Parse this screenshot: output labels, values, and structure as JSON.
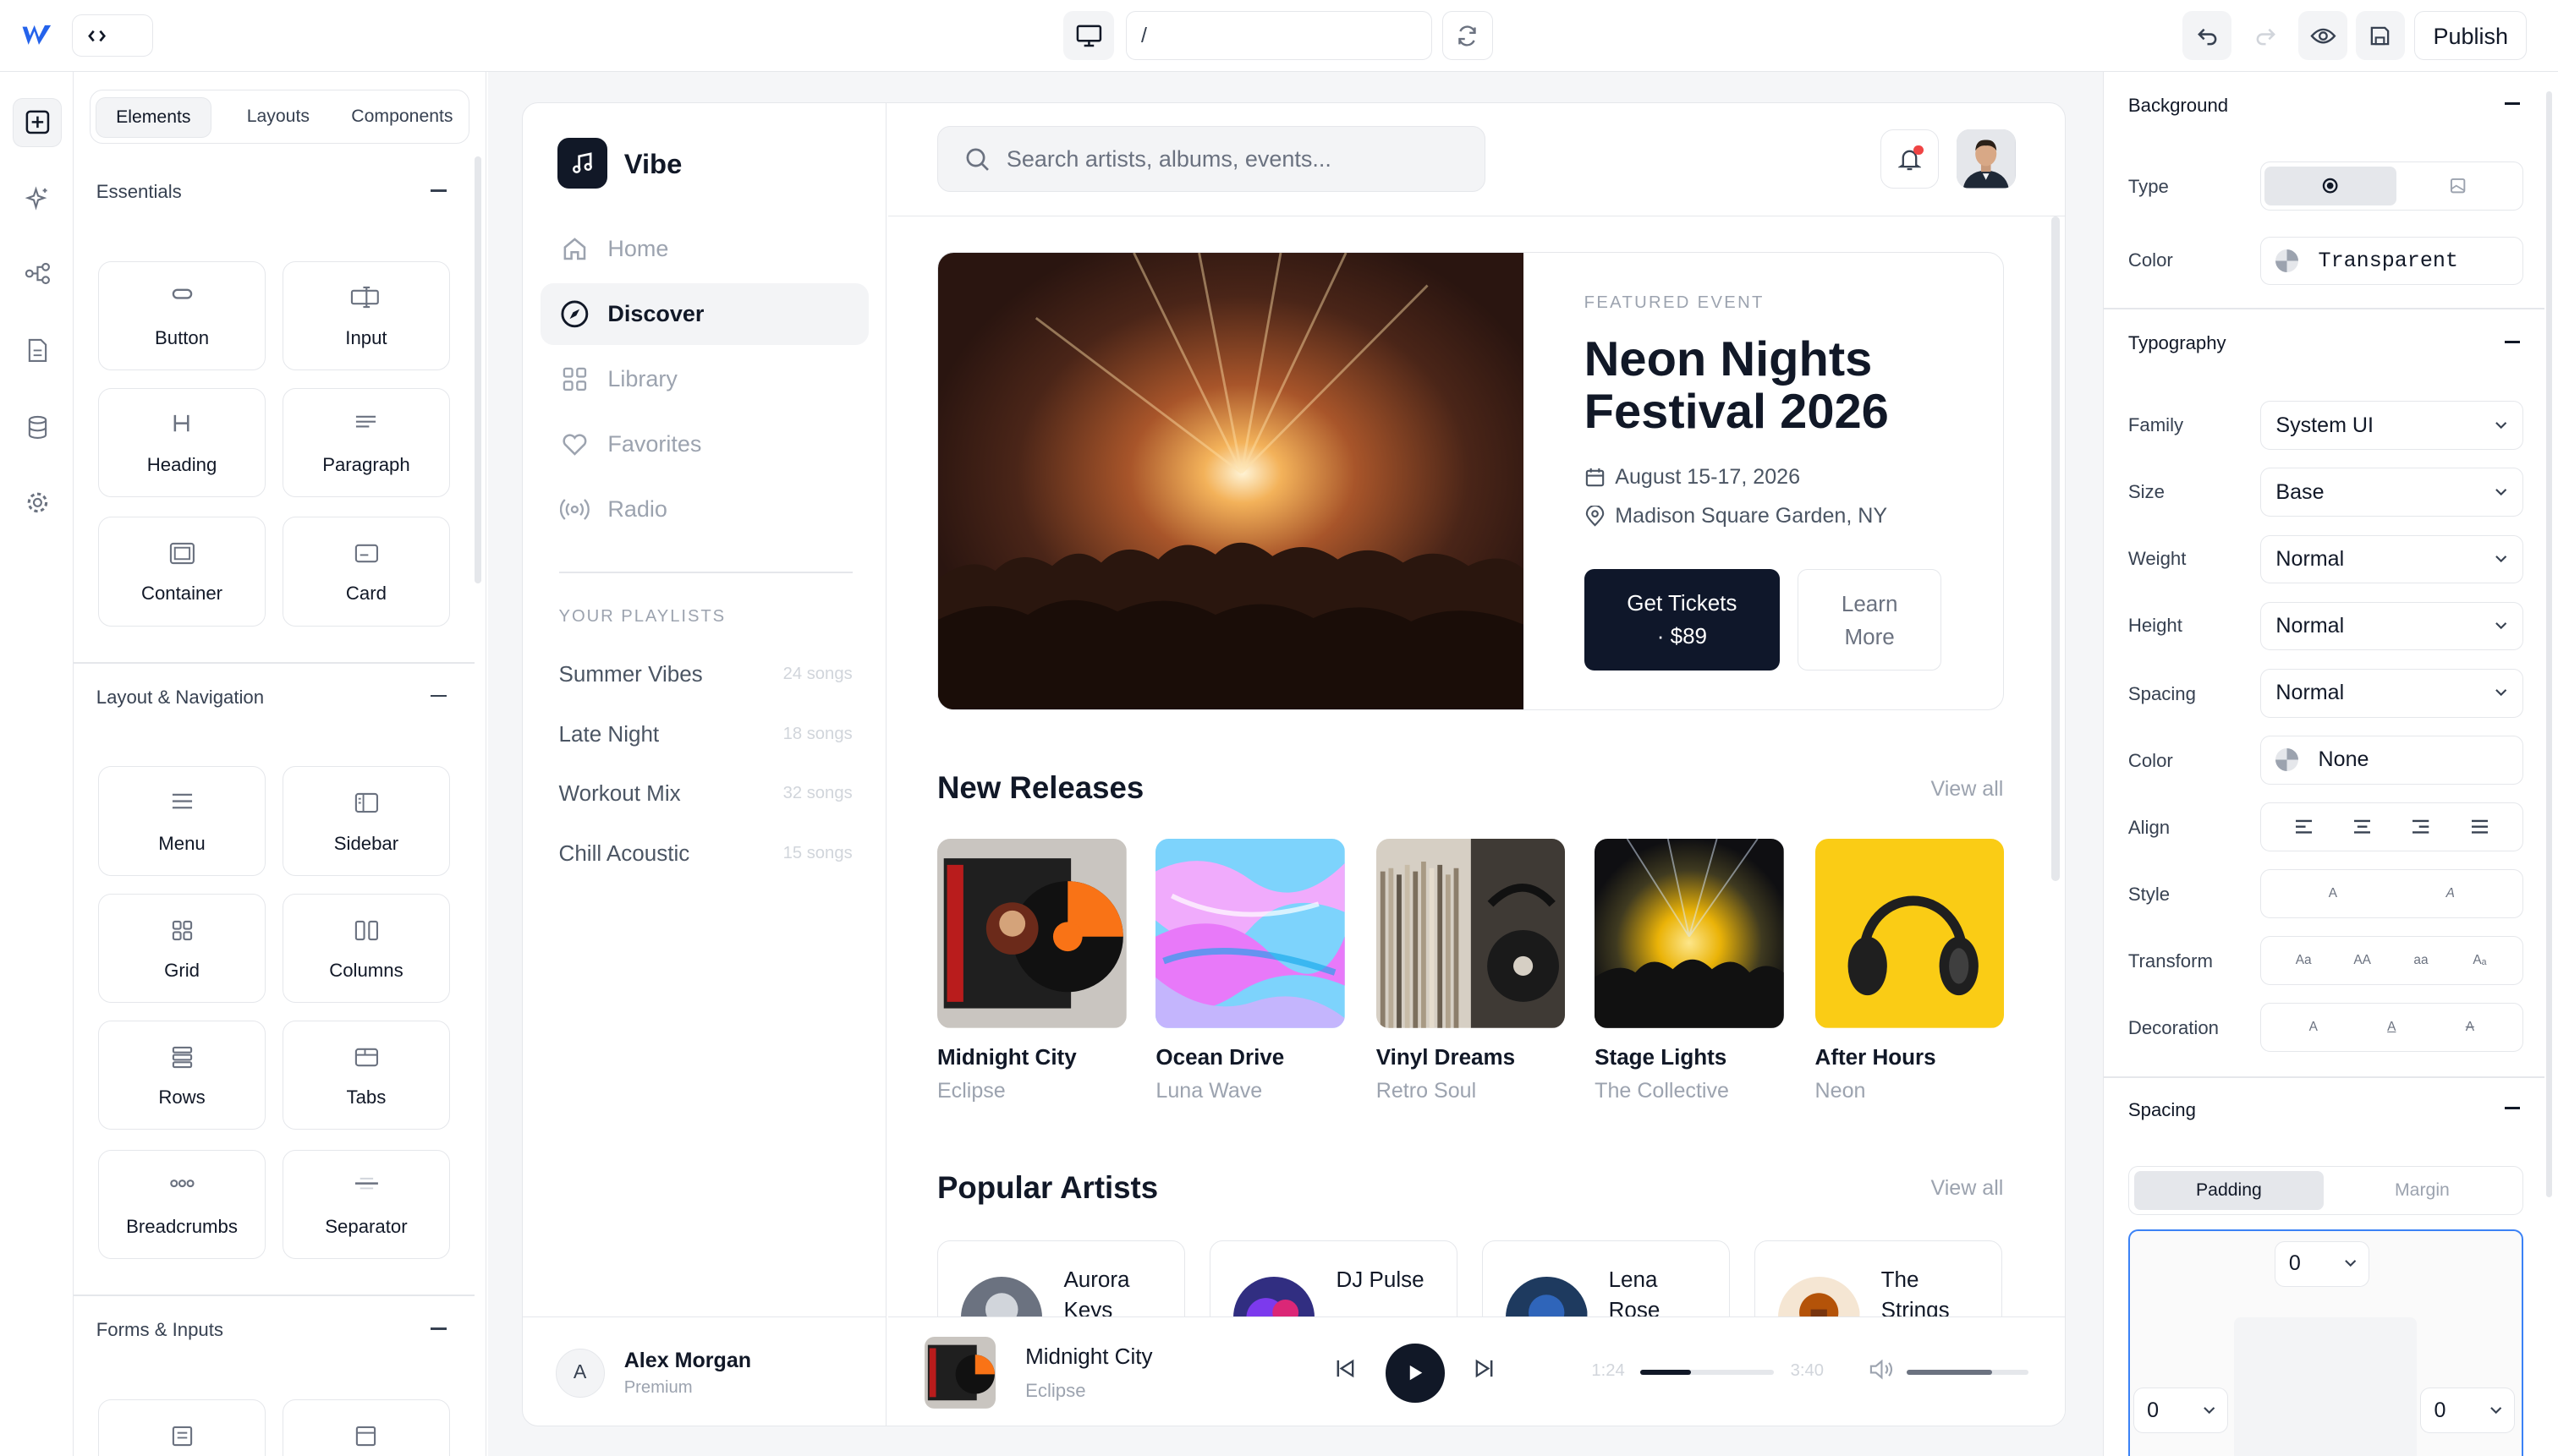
{
  "topbar": {
    "url": "/",
    "publish_label": "Publish"
  },
  "panel": {
    "tabs": [
      "Elements",
      "Layouts",
      "Components"
    ],
    "sections": [
      {
        "title": "Essentials",
        "items": [
          {
            "label": "Button",
            "icon": "button-icon"
          },
          {
            "label": "Input",
            "icon": "input-icon"
          },
          {
            "label": "Heading",
            "icon": "heading-icon"
          },
          {
            "label": "Paragraph",
            "icon": "paragraph-icon"
          },
          {
            "label": "Container",
            "icon": "container-icon"
          },
          {
            "label": "Card",
            "icon": "card-icon"
          }
        ]
      },
      {
        "title": "Layout & Navigation",
        "items": [
          {
            "label": "Menu",
            "icon": "menu-icon"
          },
          {
            "label": "Sidebar",
            "icon": "sidebar-icon"
          },
          {
            "label": "Grid",
            "icon": "grid-icon"
          },
          {
            "label": "Columns",
            "icon": "columns-icon"
          },
          {
            "label": "Rows",
            "icon": "rows-icon"
          },
          {
            "label": "Tabs",
            "icon": "tabs-icon"
          },
          {
            "label": "Breadcrumbs",
            "icon": "breadcrumbs-icon"
          },
          {
            "label": "Separator",
            "icon": "separator-icon"
          }
        ]
      },
      {
        "title": "Forms & Inputs",
        "items": []
      }
    ]
  },
  "app": {
    "brand": "Vibe",
    "nav": [
      "Home",
      "Discover",
      "Library",
      "Favorites",
      "Radio"
    ],
    "playlists_heading": "YOUR PLAYLISTS",
    "playlists": [
      {
        "name": "Summer Vibes",
        "count": "24 songs"
      },
      {
        "name": "Late Night",
        "count": "18 songs"
      },
      {
        "name": "Workout Mix",
        "count": "32 songs"
      },
      {
        "name": "Chill Acoustic",
        "count": "15 songs"
      }
    ],
    "user": {
      "initial": "A",
      "name": "Alex Morgan",
      "plan": "Premium"
    },
    "search_placeholder": "Search artists, albums, events...",
    "hero": {
      "label": "FEATURED EVENT",
      "title": "Neon Nights Festival 2026",
      "date": "August 15-17, 2026",
      "venue": "Madison Square Garden, NY",
      "primary_line1": "Get Tickets",
      "primary_line2": "· $89",
      "secondary_line1": "Learn",
      "secondary_line2": "More"
    },
    "new_releases": {
      "title": "New Releases",
      "view_all": "View all",
      "albums": [
        {
          "name": "Midnight City",
          "artist": "Eclipse"
        },
        {
          "name": "Ocean Drive",
          "artist": "Luna Wave"
        },
        {
          "name": "Vinyl Dreams",
          "artist": "Retro Soul"
        },
        {
          "name": "Stage Lights",
          "artist": "The Collective"
        },
        {
          "name": "After Hours",
          "artist": "Neon"
        }
      ]
    },
    "popular_artists": {
      "title": "Popular Artists",
      "view_all": "View all",
      "artists": [
        {
          "line1": "Aurora",
          "line2": "Keys"
        },
        {
          "line1": "DJ Pulse",
          "line2": ""
        },
        {
          "line1": "Lena",
          "line2": "Rose"
        },
        {
          "line1": "The",
          "line2": "Strings"
        }
      ]
    },
    "player": {
      "title": "Midnight City",
      "artist": "Eclipse",
      "elapsed": "1:24",
      "duration": "3:40",
      "progress": 0.38,
      "volume": 0.7
    }
  },
  "props": {
    "background": {
      "title": "Background",
      "type_label": "Type",
      "color_label": "Color",
      "color_value": "Transparent"
    },
    "typography": {
      "title": "Typography",
      "rows": [
        {
          "label": "Family",
          "value": "System UI"
        },
        {
          "label": "Size",
          "value": "Base"
        },
        {
          "label": "Weight",
          "value": "Normal"
        },
        {
          "label": "Height",
          "value": "Normal"
        },
        {
          "label": "Spacing",
          "value": "Normal"
        }
      ],
      "color_label": "Color",
      "color_value": "None",
      "align_label": "Align",
      "style_label": "Style",
      "style_opts": [
        "A",
        "A"
      ],
      "transform_label": "Transform",
      "transform_opts": [
        "Aa",
        "AA",
        "aa",
        "Aₐ"
      ],
      "decoration_label": "Decoration",
      "decoration_opts": [
        "A",
        "A",
        "A"
      ]
    },
    "spacing": {
      "title": "Spacing",
      "tabs": [
        "Padding",
        "Margin"
      ],
      "top": "0",
      "left": "0",
      "right": "0"
    }
  },
  "colors": {
    "primary": "#0f172a",
    "notification": "#ef4444",
    "selection": "#3b82f6"
  }
}
